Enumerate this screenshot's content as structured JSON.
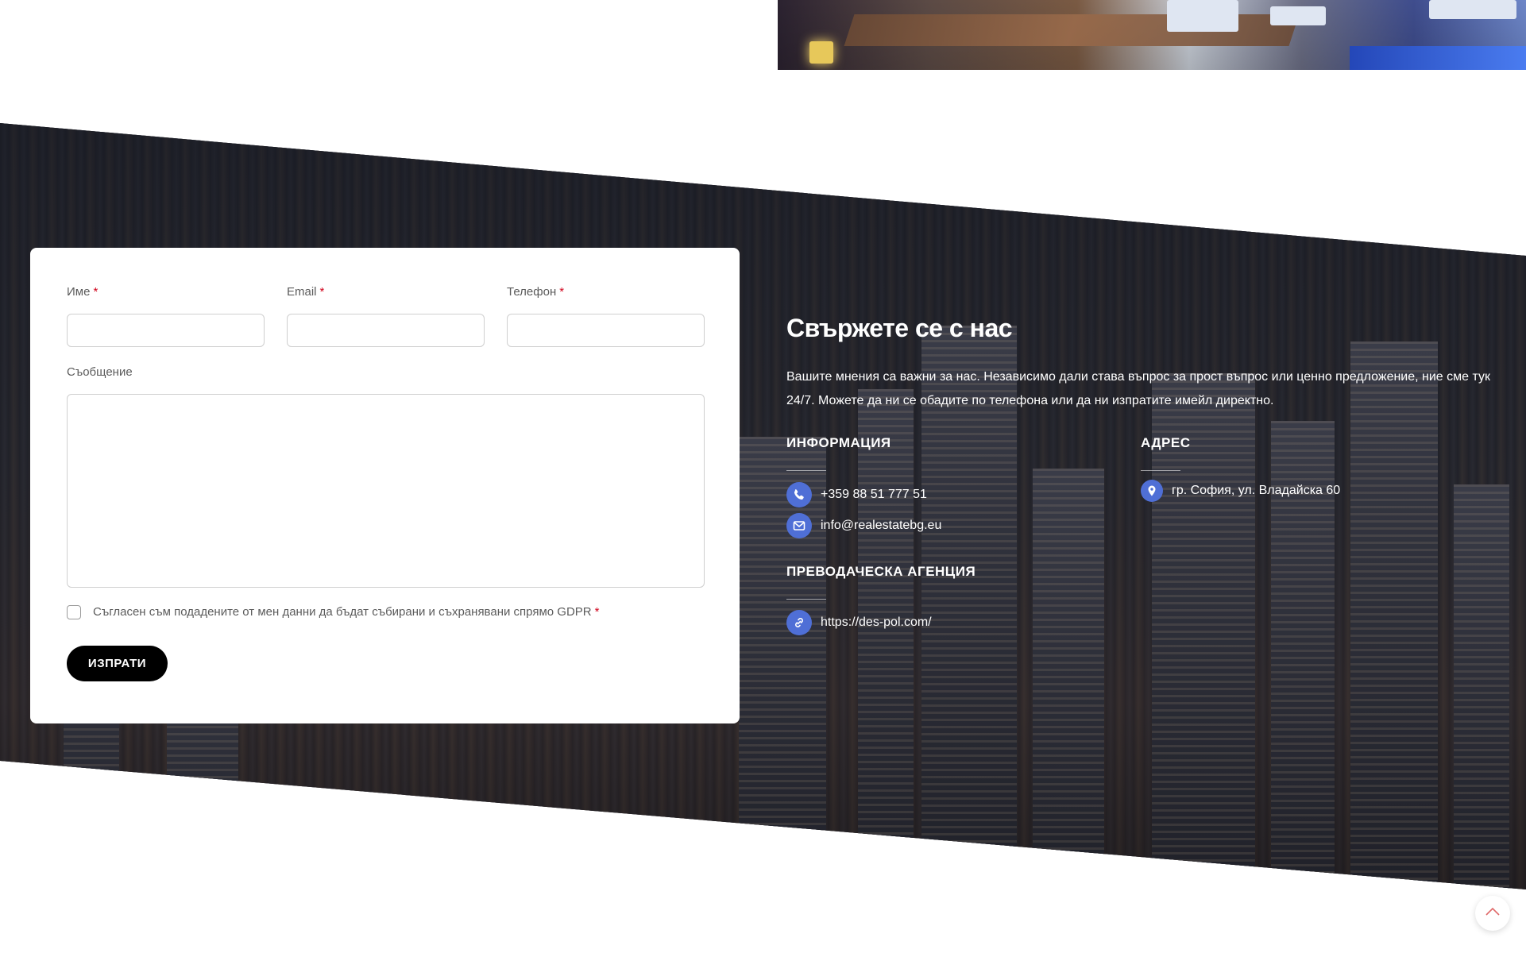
{
  "form": {
    "name_label": "Име",
    "email_label": "Email",
    "phone_label": "Телефон",
    "required_mark": "*",
    "message_label": "Съобщение",
    "consent_text": "Съгласен съм подадените от мен данни да бъдат събирани и съхранявани спрямо GDPR",
    "submit_label": "ИЗПРАТИ",
    "name_value": "",
    "email_value": "",
    "phone_value": "",
    "message_value": ""
  },
  "contact": {
    "heading": "Свържете се с нас",
    "intro": "Вашите мнения са важни за нас. Независимо дали става въпрос за прост въпрос или ценно предложение, ние сме тук 24/7. Можете да ни се обадите по телефона или да ни изпратите имейл директно.",
    "info_title": "ИНФОРМАЦИЯ",
    "phone": "+359 88 51 777 51",
    "email": "info@realestatebg.eu",
    "address_title": "АДРЕС",
    "address": "гр. София, ул. Владайска 60",
    "agency_title": "ПРЕВОДАЧЕСКА АГЕНЦИЯ",
    "agency_url": "https://des-pol.com/"
  },
  "icons": {
    "phone": "phone-icon",
    "email": "envelope-icon",
    "location": "map-pin-icon",
    "link": "link-icon",
    "back_to_top": "chevron-up-icon"
  },
  "colors": {
    "accent": "#4f6fd6",
    "required": "#d0021b",
    "button": "#000000"
  }
}
